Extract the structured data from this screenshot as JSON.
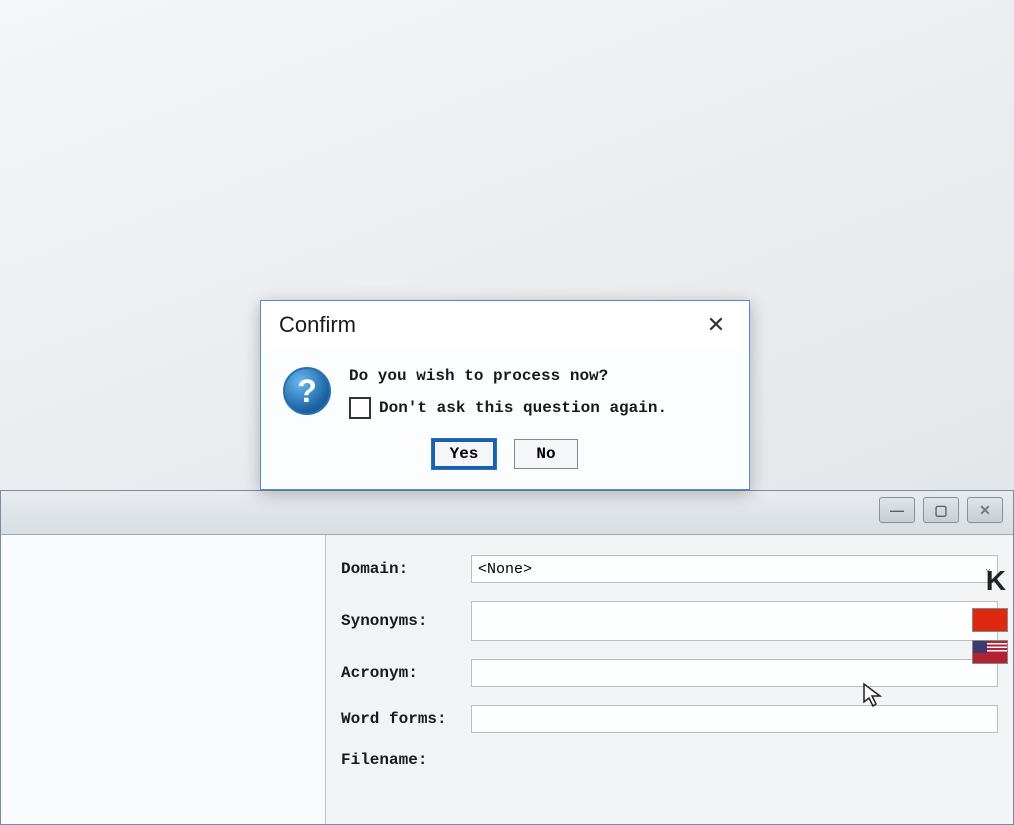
{
  "dialog": {
    "title": "Confirm",
    "message": "Do you wish to process now?",
    "checkbox_label": "Don't ask this question again.",
    "yes_label": "Yes",
    "no_label": "No",
    "icon_glyph": "?"
  },
  "window_controls": {
    "minimize": "—",
    "maximize": "▢",
    "close": "✕"
  },
  "form": {
    "domain_label": "Domain:",
    "domain_value": "<None>",
    "synonyms_label": "Synonyms:",
    "synonyms_value": "",
    "acronym_label": "Acronym:",
    "acronym_value": "",
    "wordforms_label": "Word forms:",
    "wordforms_value": "",
    "filename_label": "Filename:"
  },
  "right_panel": {
    "letter": "K"
  }
}
